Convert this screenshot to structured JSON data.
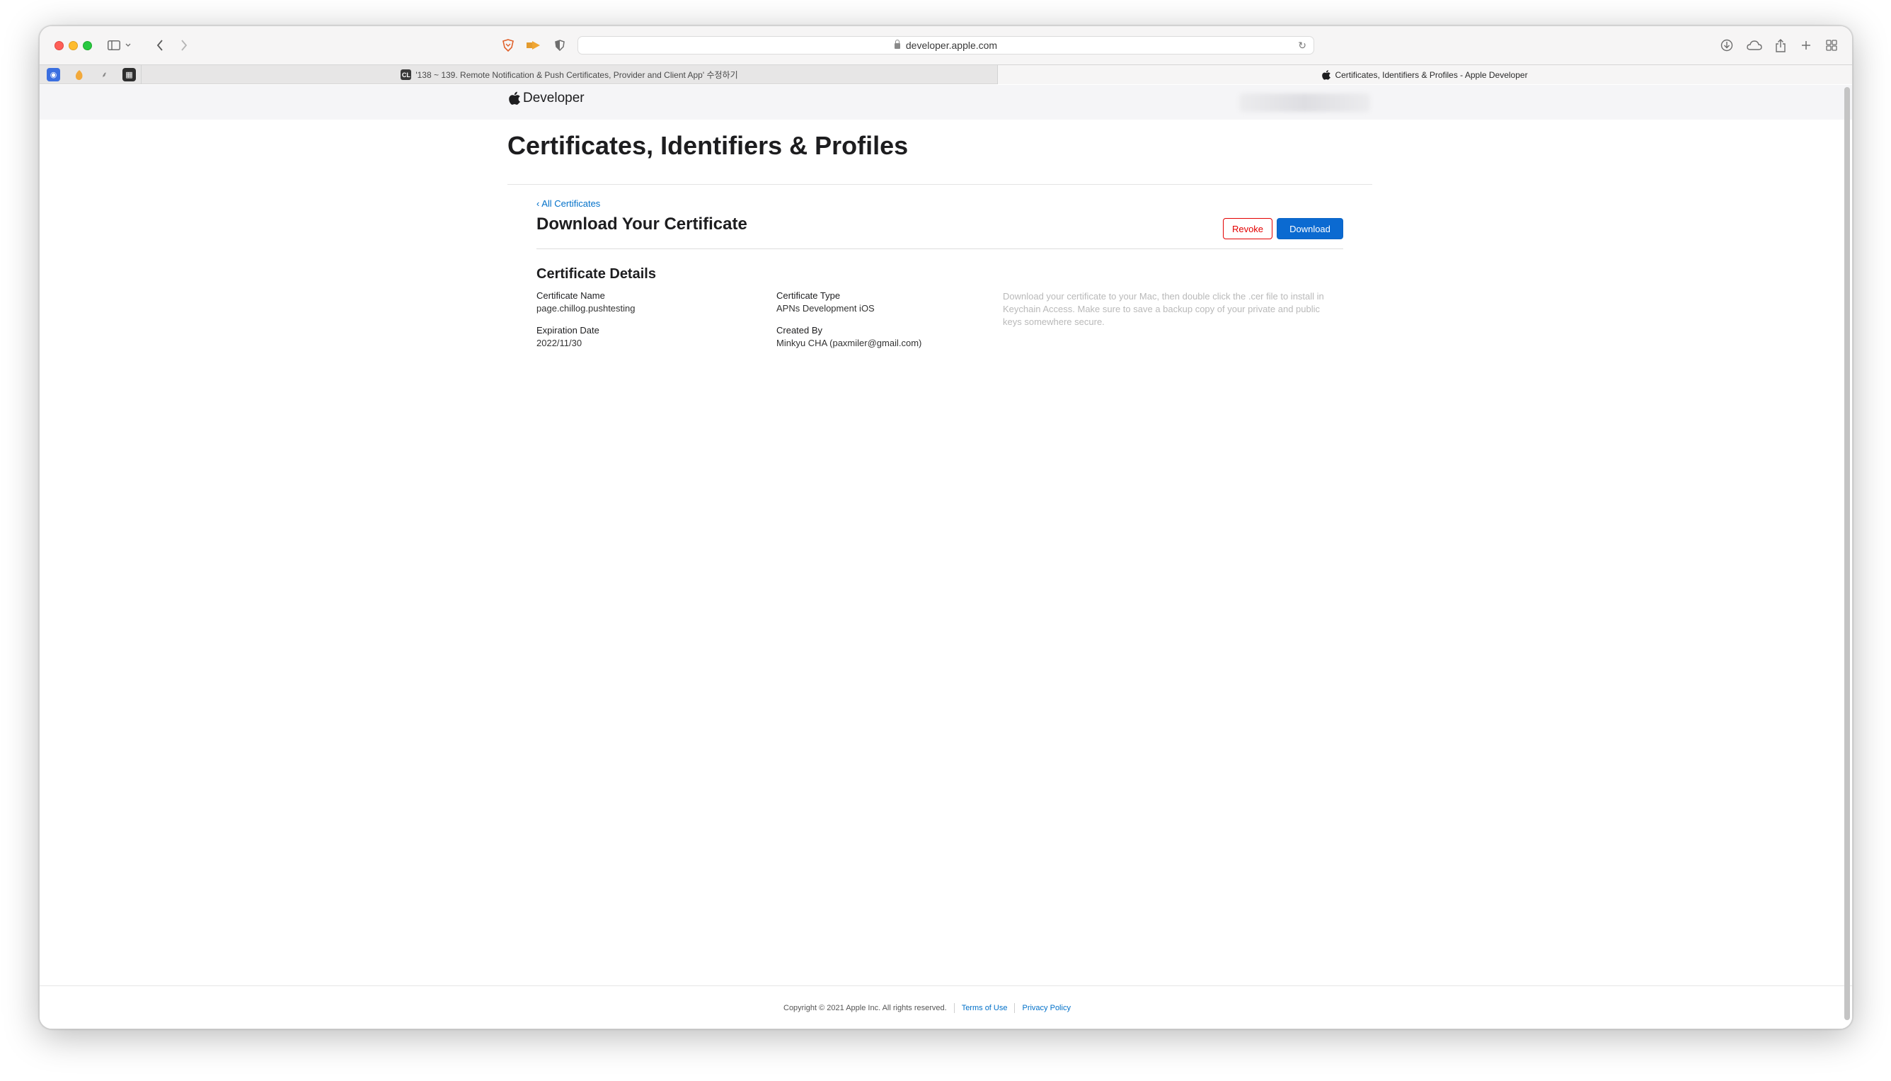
{
  "browser": {
    "url": "developer.apple.com",
    "tabs": [
      {
        "title": "'138 ~ 139. Remote Notification & Push Certificates, Provider and Client App' 수정하기",
        "active": false,
        "favicon": "CL"
      },
      {
        "title": "Certificates, Identifiers & Profiles - Apple Developer",
        "active": true
      }
    ],
    "pinned_tabs": [
      "pinned-tab-blue-icon",
      "pinned-tab-orange-icon",
      "pinned-tab-feather-icon",
      "pinned-tab-dark-icon"
    ]
  },
  "nav": {
    "brand": "Developer"
  },
  "page": {
    "title": "Certificates, Identifiers & Profiles",
    "back_link": "‹ All Certificates",
    "section_title": "Download Your Certificate",
    "revoke_label": "Revoke",
    "download_label": "Download",
    "details_title": "Certificate Details",
    "fields": {
      "certificate_name_label": "Certificate Name",
      "certificate_name_value": "page.chillog.pushtesting",
      "certificate_type_label": "Certificate Type",
      "certificate_type_value": "APNs Development iOS",
      "expiration_date_label": "Expiration Date",
      "expiration_date_value": "2022/11/30",
      "created_by_label": "Created By",
      "created_by_value": "Minkyu CHA (paxmiler@gmail.com)"
    },
    "help_text": "Download your certificate to your Mac, then double click the .cer file to install in Keychain Access. Make sure to save a backup copy of your private and public keys somewhere secure."
  },
  "footer": {
    "copyright": "Copyright © 2021 Apple Inc. All rights reserved.",
    "terms": "Terms of Use",
    "privacy": "Privacy Policy"
  },
  "colors": {
    "link": "#0070c9",
    "revoke": "#e30000",
    "download_bg": "#0b6ad1"
  }
}
